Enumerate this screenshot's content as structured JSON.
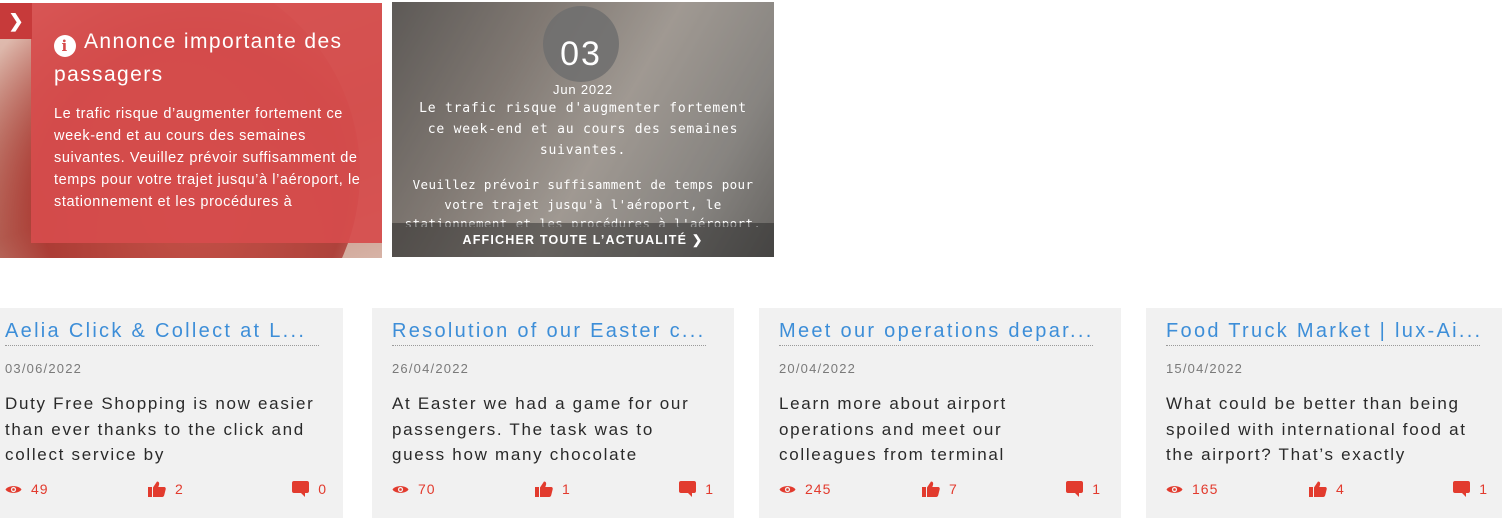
{
  "announcement": {
    "toggle_icon": "chevron-right-icon",
    "title": "Annonce importante des passagers",
    "body": "Le trafic risque d’augmenter fortement ce week-end et au cours des semaines suivantes. Veuillez prévoir suffisamment de temps pour votre trajet jusqu’à l’aéroport, le stationnement et les procédures à"
  },
  "news": {
    "day": "03",
    "month": "Jun 2022",
    "paragraph1": "Le trafic risque d'augmenter fortement ce week-end et au cours des semaines suivantes.",
    "paragraph2": "Veuillez prévoir suffisamment de temps pour votre trajet jusqu'à l'aéroport, le stationnement et les procédures à l'aéroport. Veuillez suivre",
    "show_all": "AFFICHER TOUTE L’ACTUALITÉ ❯"
  },
  "cards": [
    {
      "title": "Aelia Click & Collect at L...",
      "date": "03/06/2022",
      "excerpt": "Duty Free Shopping is now easier than ever thanks to the click and collect service by",
      "views": "49",
      "likes": "2",
      "comments": "0"
    },
    {
      "title": "Resolution of our Easter c...",
      "date": "26/04/2022",
      "excerpt": "At Easter we had a game for our passengers. The task was to guess how many chocolate",
      "views": "70",
      "likes": "1",
      "comments": "1"
    },
    {
      "title": "Meet our operations depar...",
      "date": "20/04/2022",
      "excerpt": "Learn more about airport operations and meet our colleagues from terminal",
      "views": "245",
      "likes": "7",
      "comments": "1"
    },
    {
      "title": "Food Truck Market | lux-Ai...",
      "date": "15/04/2022",
      "excerpt": "What could be better than being spoiled with international food at the airport? That’s exactly",
      "views": "165",
      "likes": "4",
      "comments": "1"
    }
  ],
  "colors": {
    "accent_red": "#e23b2e",
    "title_blue": "#3d8ed8",
    "panel_red": "#d64c4c",
    "card_bg": "#f1f1f1"
  }
}
